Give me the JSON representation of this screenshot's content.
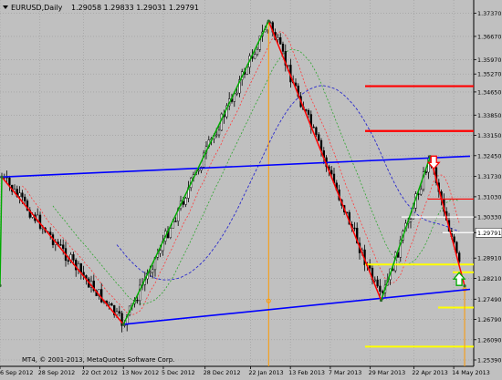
{
  "header": {
    "symbol_timeframe": "EURUSD,Daily",
    "ohlc": "1.29058 1.29833 1.29031 1.29791"
  },
  "copyright": "MT4, © 2001-2013, MetaQuotes Software Corp.",
  "colors": {
    "background": "#c0c0c0",
    "candle": "#000000",
    "zigzag_up": "#00aa00",
    "zigzag_down": "#ff0000",
    "channel": "#0000ff",
    "level_red": "#ff0000",
    "level_yellow": "#ffff00",
    "level_white": "#ffffff",
    "vertical_markers": "#ff9900",
    "ma_fast": "#ff3b3b",
    "ma_mid": "#2fa52f",
    "ma_slow": "#2a2acc"
  },
  "chart_data": {
    "type": "candlestick",
    "symbol": "EURUSD",
    "timeframe": "Daily",
    "y_range": [
      1.2539,
      1.3767
    ],
    "y_ticks": [
      1.3737,
      1.3657,
      1.3577,
      1.3527,
      1.3465,
      1.3385,
      1.3315,
      1.3245,
      1.3173,
      1.3103,
      1.3033,
      1.2979,
      1.2891,
      1.2821,
      1.2749,
      1.2679,
      1.2609,
      1.2539
    ],
    "y_tick_labels": [
      "1.37370",
      "1.36670",
      "1.35970",
      "1.35270",
      "1.34650",
      "1.33850",
      "1.33150",
      "1.32450",
      "1.31730",
      "1.31030",
      "1.30330",
      "1.29791",
      "1.28910",
      "1.28210",
      "1.27490",
      "1.26790",
      "1.26090",
      "1.25390"
    ],
    "current_price": "1.29791",
    "x_labels": [
      "6 Sep 2012",
      "28 Sep 2012",
      "22 Oct 2012",
      "13 Nov 2012",
      "5 Dec 2012",
      "28 Dec 2012",
      "22 Jan 2013",
      "13 Feb 2013",
      "7 Mar 2013",
      "29 Mar 2013",
      "22 Apr 2013",
      "14 May 2013"
    ],
    "zigzag_points": [
      {
        "date": "6 Sep 2012",
        "price": 1.2796
      },
      {
        "date": "7 Sep 2012",
        "price": 1.3171
      },
      {
        "date": "13 Nov 2012",
        "price": 1.2662
      },
      {
        "date": "1 Feb 2013",
        "price": 1.371
      },
      {
        "date": "4 Apr 2013",
        "price": 1.2745
      },
      {
        "date": "1 May 2013",
        "price": 1.3242
      },
      {
        "date": "20 May 2013",
        "price": 1.2795
      }
    ],
    "channel_lines": [
      {
        "from": {
          "date": "6 Sep 2012",
          "price": 1.3171
        },
        "to": {
          "date": "23 May 2013",
          "price": 1.3243
        }
      },
      {
        "from": {
          "date": "13 Nov 2012",
          "price": 1.2662
        },
        "to": {
          "date": "23 May 2013",
          "price": 1.2783
        }
      }
    ],
    "horizontal_levels": [
      {
        "price": 1.3485,
        "color": "red"
      },
      {
        "price": 1.333,
        "color": "red"
      },
      {
        "price": 1.3095,
        "color": "red"
      },
      {
        "price": 1.3033,
        "color": "white"
      },
      {
        "price": 1.2979,
        "color": "white"
      },
      {
        "price": 1.2869,
        "color": "yellow"
      },
      {
        "price": 1.2842,
        "color": "yellow"
      },
      {
        "price": 1.272,
        "color": "yellow"
      },
      {
        "price": 1.2585,
        "color": "yellow"
      }
    ],
    "arrows": [
      {
        "direction": "down",
        "date": "3 May 2013",
        "price": 1.3215,
        "color": "red"
      },
      {
        "direction": "up",
        "date": "17 May 2013",
        "price": 1.2825,
        "color": "green"
      }
    ]
  }
}
